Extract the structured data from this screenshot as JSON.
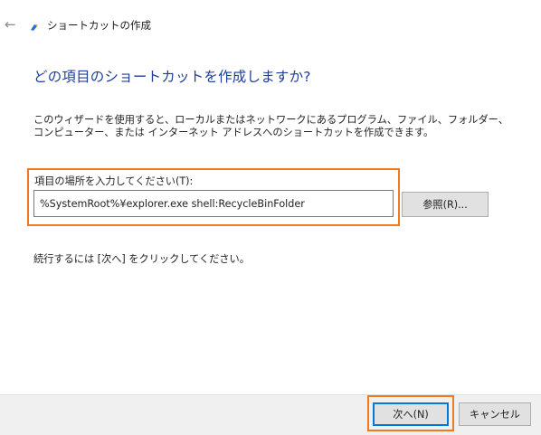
{
  "window": {
    "title": "ショートカットの作成",
    "back_icon": "back-arrow-icon",
    "close_icon": "close-icon"
  },
  "main": {
    "heading": "どの項目のショートカットを作成しますか?",
    "description": "このウィザードを使用すると、ローカルまたはネットワークにあるプログラム、ファイル、フォルダー、コンピューター、または インターネット アドレスへのショートカットを作成できます。",
    "location_label": "項目の場所を入力してください(T):",
    "location_value": "%SystemRoot%¥explorer.exe shell:RecycleBinFolder",
    "browse_label": "参照(R)...",
    "hint": "続行するには [次へ] をクリックしてください。"
  },
  "footer": {
    "next_label": "次へ(N)",
    "cancel_label": "キャンセル"
  },
  "colors": {
    "heading": "#1f3e9a",
    "highlight": "#ee7b22",
    "focus": "#0078d7",
    "footer_bg": "#f0f0f0",
    "button_bg": "#e1e1e1"
  }
}
